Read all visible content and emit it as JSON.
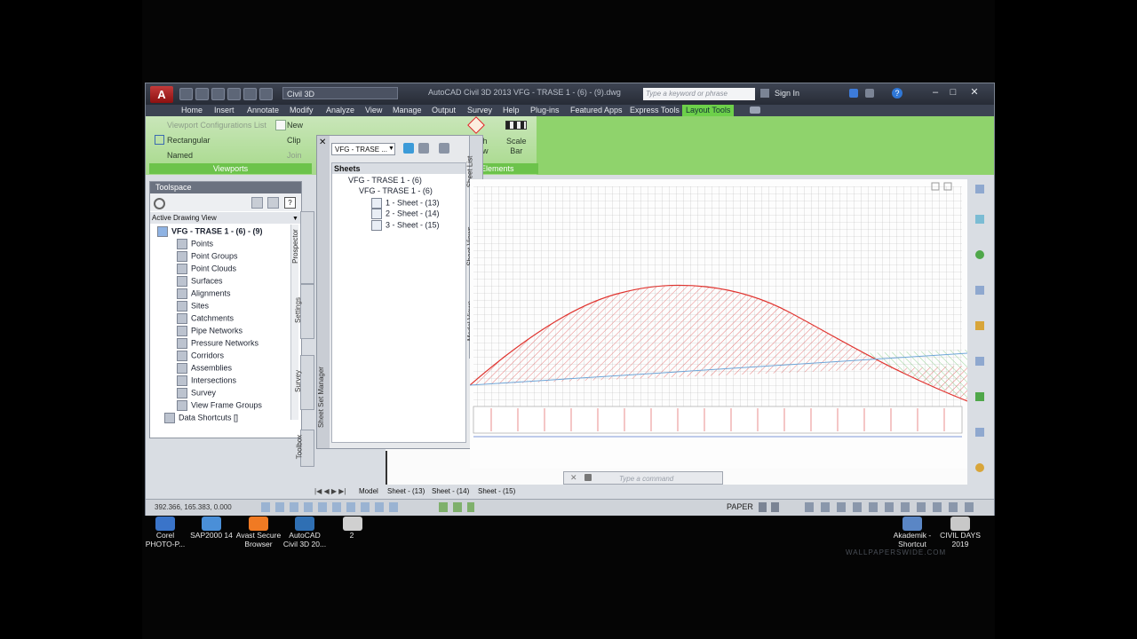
{
  "window": {
    "workspace": "Civil 3D",
    "title": "AutoCAD Civil 3D 2013    VFG - TRASE 1 - (6) - (9).dwg",
    "search_placeholder": "Type a keyword or phrase",
    "sign_in": "Sign In",
    "logo": "A"
  },
  "menu_tabs": [
    "Home",
    "Insert",
    "Annotate",
    "Modify",
    "Analyze",
    "View",
    "Manage",
    "Output",
    "Survey",
    "Help",
    "Plug-ins",
    "Featured Apps",
    "Express Tools",
    "Layout Tools"
  ],
  "active_tab": "Layout Tools",
  "ribbon": {
    "viewport_config": "Viewport Configurations List",
    "new": "New",
    "rectangular": "Rectangular",
    "clip": "Clip",
    "named": "Named",
    "join": "Join",
    "viewports_label": "Viewports",
    "north_arrow": "rth\now",
    "scale_bar": "Scale\nBar",
    "elements_label": "Elements"
  },
  "toolspace": {
    "title": "Toolspace",
    "view": "Active Drawing View",
    "root": "VFG - TRASE 1 - (6) - (9)",
    "items": [
      "Points",
      "Point Groups",
      "Point Clouds",
      "Surfaces",
      "Alignments",
      "Sites",
      "Catchments",
      "Pipe Networks",
      "Pressure Networks",
      "Corridors",
      "Assemblies",
      "Intersections",
      "Survey",
      "View Frame Groups"
    ],
    "data_shortcuts": "Data Shortcuts []",
    "vertical_tabs": [
      "Prospector",
      "Settings",
      "Survey",
      "Toolbox"
    ]
  },
  "sheet_set": {
    "combo": "VFG - TRASE ...",
    "sheets_header": "Sheets",
    "tree": [
      "VFG - TRASE 1 - (6)",
      "VFG - TRASE 1 - (6)",
      "1 - Sheet - (13)",
      "2 - Sheet - (14)",
      "3 - Sheet - (15)"
    ],
    "vertical_tabs": [
      "Sheet List",
      "Sheet Views",
      "Model Views"
    ],
    "manager_label": "Sheet Set Manager"
  },
  "command_placeholder": "Type a command",
  "layout_tabs": [
    "Model",
    "Sheet - (13)",
    "Sheet - (14)",
    "Sheet - (15)"
  ],
  "status": {
    "coords": "392.366, 165.383, 0.000",
    "paper": "PAPER"
  },
  "taskbar": {
    "left": [
      {
        "label": "Corel\nPHOTO-P...",
        "color": "#3a74c9"
      },
      {
        "label": "SAP2000 14",
        "color": "#4a8fd8"
      },
      {
        "label": "Avast Secure\nBrowser",
        "color": "#f07a23"
      },
      {
        "label": "AutoCAD\nCivil 3D 20...",
        "color": "#2f6fb3"
      },
      {
        "label": "2",
        "color": "#d0d0d0"
      }
    ],
    "right": [
      {
        "label": "Akademik -\nShortcut",
        "color": "#5a86c5"
      },
      {
        "label": "CIVIL DAYS\n2019",
        "color": "#c8c8c8"
      }
    ]
  },
  "watermark": "WALLPAPERSWIDE.COM",
  "colors": {
    "accent_tab": "#6dd04a",
    "profile": "#e0342f",
    "baseline": "#6fa6d8"
  }
}
